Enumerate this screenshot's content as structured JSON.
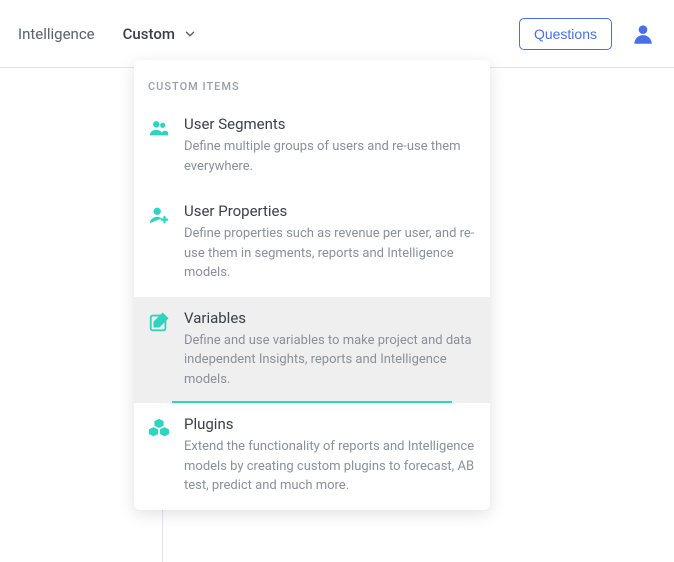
{
  "topbar": {
    "nav": {
      "intelligence": "Intelligence",
      "custom": "Custom"
    },
    "questions_label": "Questions"
  },
  "dropdown": {
    "header": "CUSTOM ITEMS",
    "items": [
      {
        "title": "User Segments",
        "description": "Define multiple groups of users and re-use them everywhere."
      },
      {
        "title": "User Properties",
        "description": "Define properties such as revenue per user, and re-use them in segments, reports and Intelligence models."
      },
      {
        "title": "Variables",
        "description": "Define and use variables to make project and data independent Insights, reports and Intelligence models."
      },
      {
        "title": "Plugins",
        "description": "Extend the functionality of reports and Intelligence models by creating custom plugins to forecast, AB test, predict and much more."
      }
    ]
  }
}
